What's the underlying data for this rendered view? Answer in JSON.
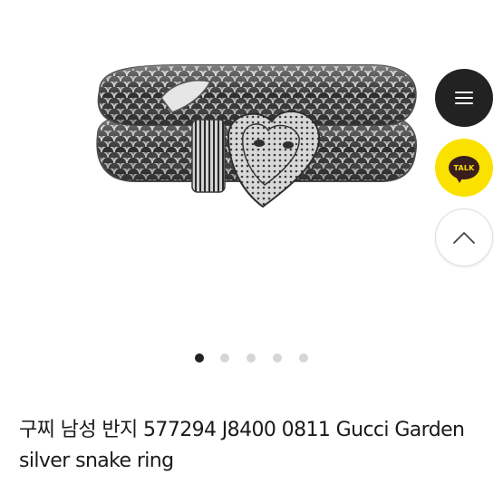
{
  "product": {
    "title": "구찌 남성 반지 577294 J8400 0811 Gucci Garden silver snake ring"
  },
  "image": {
    "subject": "silver snake ring"
  },
  "carousel": {
    "slide_count": 5,
    "active_index": 0
  },
  "floating_buttons": {
    "menu": {
      "icon": "hamburger-menu-icon"
    },
    "kakao_talk": {
      "label": "TALK",
      "icon": "kakaotalk-icon"
    },
    "scroll_top": {
      "icon": "chevron-up-icon"
    }
  },
  "colors": {
    "menu_button": "#222222",
    "kakao_yellow": "#fae100",
    "kakao_brown": "#3a1d1d",
    "dot_active": "#222222",
    "dot_inactive": "#d6d6d6",
    "title_text": "#1a1a1a"
  }
}
